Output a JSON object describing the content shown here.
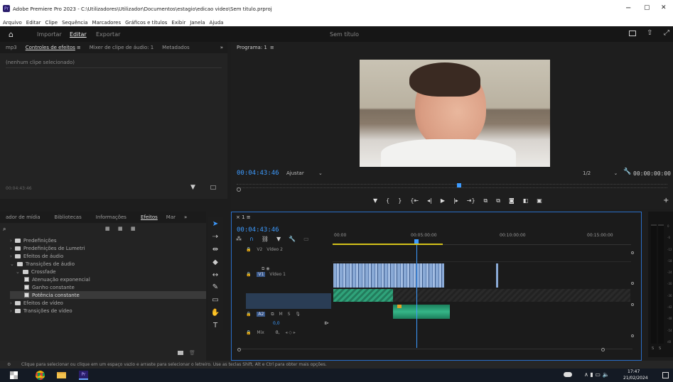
{
  "titlebar": {
    "title": "Adobe Premiere Pro 2023 - C:\\Utilizadores\\Utilizador\\Documentos\\estagio\\edicao video\\Sem titulo.prproj",
    "min": "−",
    "max": "▢",
    "close": "✕"
  },
  "menu": [
    "Arquivo",
    "Editar",
    "Clipe",
    "Sequência",
    "Marcadores",
    "Gráficos e títulos",
    "Exibir",
    "Janela",
    "Ajuda"
  ],
  "workspace": {
    "tabs": [
      "Importar",
      "Editar",
      "Exportar"
    ],
    "active": "Editar",
    "project_title": "Sem título"
  },
  "effect_controls": {
    "tabs": [
      "mp3",
      "Controles de efeitos",
      "Mixer de clipe de áudio: 1",
      "Metadados"
    ],
    "menu_glyph": "≡",
    "more": "»",
    "empty_text": "(nenhum clipe selecionado)",
    "timecode": "00:04:43:46"
  },
  "program": {
    "label": "Programa: 1",
    "menu_glyph": "≡",
    "timecode": "00:04:43:46",
    "fit": "Ajustar",
    "resolution": "1/2",
    "duration": "00:00:00:00"
  },
  "effects": {
    "tabs": [
      "ador de mídia",
      "Bibliotecas",
      "Informações",
      "Efeitos",
      "Mar"
    ],
    "active": "Efeitos",
    "search_placeholder": "",
    "tree": [
      {
        "label": "Predefinições",
        "indent": 0,
        "open": false,
        "kind": "folder"
      },
      {
        "label": "Predefinições de Lumetri",
        "indent": 0,
        "open": false,
        "kind": "folder"
      },
      {
        "label": "Efeitos de áudio",
        "indent": 0,
        "open": false,
        "kind": "folder"
      },
      {
        "label": "Transições de áudio",
        "indent": 0,
        "open": true,
        "kind": "folder"
      },
      {
        "label": "Crossfade",
        "indent": 1,
        "open": true,
        "kind": "folder"
      },
      {
        "label": "Atenuação exponencial",
        "indent": 2,
        "open": false,
        "kind": "fx"
      },
      {
        "label": "Ganho constante",
        "indent": 2,
        "open": false,
        "kind": "fx"
      },
      {
        "label": "Potência constante",
        "indent": 2,
        "open": false,
        "kind": "fx",
        "selected": true
      },
      {
        "label": "Efeitos de vídeo",
        "indent": 0,
        "open": false,
        "kind": "folder"
      },
      {
        "label": "Transições de vídeo",
        "indent": 0,
        "open": false,
        "kind": "folder"
      }
    ]
  },
  "timeline": {
    "tab": "1",
    "timecode": "00:04:43:46",
    "ruler": [
      "00:00",
      "00:05:00:00",
      "00:10:00:00",
      "00:15:00:00"
    ],
    "tracks": [
      {
        "id": "V2",
        "name": "Vídeo 2"
      },
      {
        "id": "V1",
        "name": "Vídeo 1"
      },
      {
        "id": "A1",
        "name": ""
      },
      {
        "id": "A2",
        "name": "",
        "m": "M",
        "s": "S"
      },
      {
        "id": "Mix",
        "name": "Mix",
        "value": "0,0"
      }
    ],
    "audio_gain": "0,0",
    "mix_value": "0,"
  },
  "meter": {
    "labels": [
      "0",
      "-6",
      "-12",
      "-18",
      "-24",
      "-30",
      "-36",
      "-42",
      "-48",
      "-54",
      "dB"
    ],
    "solo": [
      "S",
      "S"
    ]
  },
  "status": "Clique para selecionar ou clique em um espaço vazio e arraste para selecionar o letreiro. Use as teclas Shift, Alt e Ctrl para obter mais opções.",
  "taskbar": {
    "time": "17:47",
    "date": "21/02/2024"
  }
}
